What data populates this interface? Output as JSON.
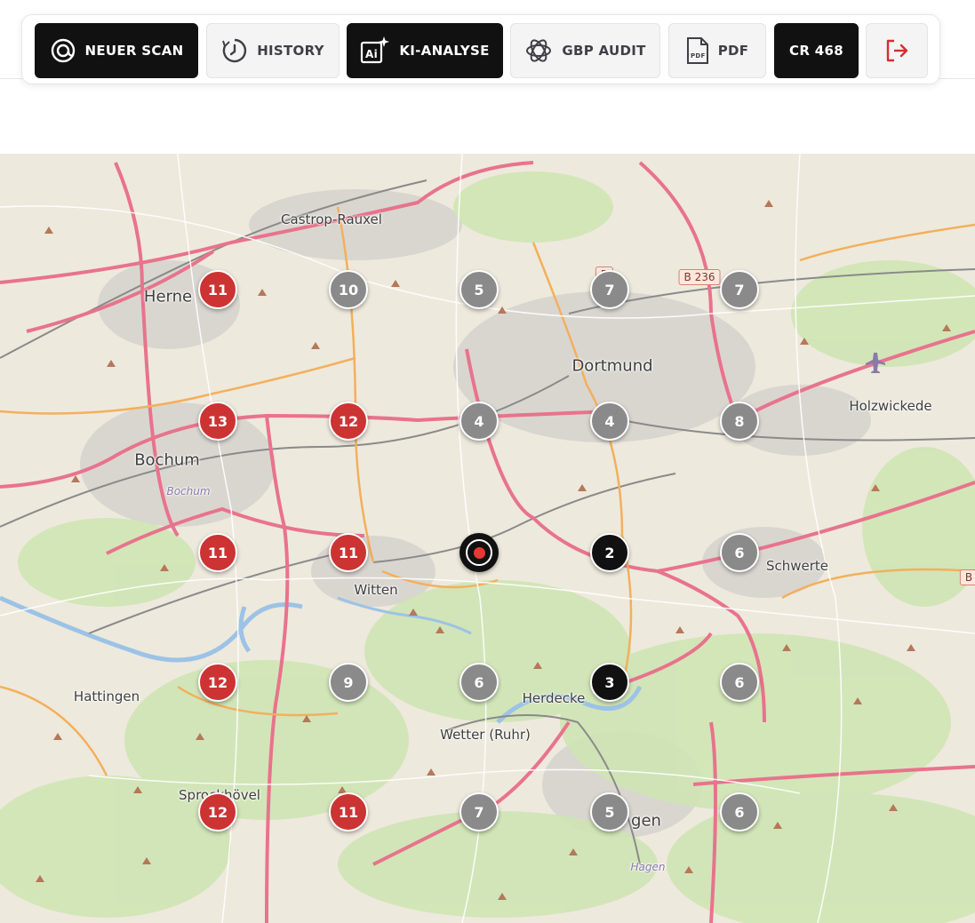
{
  "toolbar": {
    "buttons": [
      {
        "label": "NEUER SCAN",
        "icon": "target-scan-icon"
      },
      {
        "label": "HISTORY",
        "icon": "clock-history-icon"
      },
      {
        "label": "KI-ANALYSE",
        "icon": "ai-sparkle-icon"
      },
      {
        "label": "GBP AUDIT",
        "icon": "openai-knot-icon"
      },
      {
        "label": "PDF",
        "icon": "pdf-file-icon"
      },
      {
        "label": "CR 468",
        "icon": ""
      },
      {
        "label": "",
        "icon": "logout-icon"
      }
    ],
    "colors": {
      "dark": "#111111",
      "light": "#f4f4f5",
      "logout": "#d32f2f"
    }
  },
  "map": {
    "cities": [
      {
        "label": "Castrop-Rauxel"
      },
      {
        "label": "Herne"
      },
      {
        "label": "Dortmund"
      },
      {
        "label": "Holzwickede"
      },
      {
        "label": "Bochum"
      },
      {
        "label": "Bochum"
      },
      {
        "label": "Witten"
      },
      {
        "label": "Schwerte"
      },
      {
        "label": "Hattingen"
      },
      {
        "label": "Herdecke"
      },
      {
        "label": "Wetter (Ruhr)"
      },
      {
        "label": "Sprockhövel"
      },
      {
        "label": "gen"
      },
      {
        "label": "Hagen"
      }
    ],
    "road_shields": [
      "B 236",
      "B",
      "B"
    ],
    "grid": [
      [
        "11",
        "10",
        "5",
        "7",
        "7"
      ],
      [
        "13",
        "12",
        "4",
        "4",
        "8"
      ],
      [
        "11",
        "11",
        "",
        "2",
        "6"
      ],
      [
        "12",
        "9",
        "6",
        "3",
        "6"
      ],
      [
        "12",
        "11",
        "7",
        "5",
        "6"
      ]
    ],
    "marker_colors": {
      "red": "#cc3333",
      "gray": "#8a8a8a",
      "black": "#111111"
    }
  }
}
